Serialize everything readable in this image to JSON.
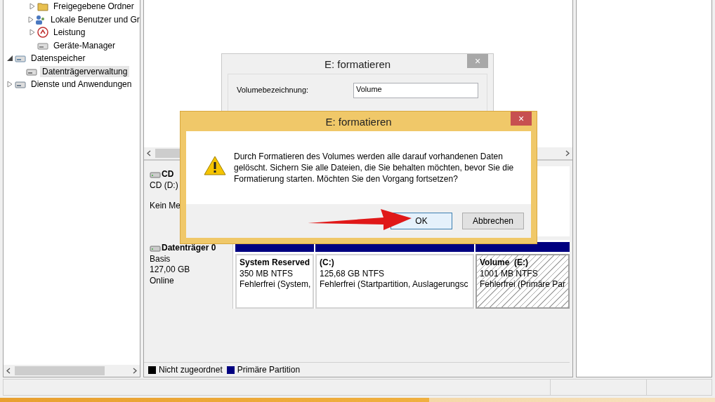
{
  "tree": {
    "orphan_children": [
      {
        "label": "Freigegebene Ordner",
        "kind": "folder",
        "expanded": false,
        "selected": false
      },
      {
        "label": "Lokale Benutzer und Gr",
        "kind": "users",
        "expanded": false,
        "selected": false
      },
      {
        "label": "Leistung",
        "kind": "gauge",
        "expanded": false,
        "selected": false
      },
      {
        "label": "Geräte-Manager",
        "kind": "device",
        "selected": false
      }
    ],
    "items": [
      {
        "label": "Datenspeicher",
        "kind": "storage",
        "expanded": true,
        "selected": false,
        "children": [
          {
            "label": "Datenträgerverwaltung",
            "kind": "disk",
            "selected": true
          }
        ]
      },
      {
        "label": "Dienste und Anwendungen",
        "kind": "services",
        "expanded": false,
        "selected": false
      }
    ]
  },
  "cd_drive": {
    "title": "CD",
    "drive": "CD (D:)",
    "media": "Kein Me"
  },
  "disk": {
    "title": "Datenträger 0",
    "type": "Basis",
    "size": "127,00 GB",
    "status": "Online",
    "partitions": [
      {
        "name": "System Reserved",
        "size": "350 MB NTFS",
        "health": "Fehlerfrei (System,",
        "selected": false
      },
      {
        "name": "(C:)",
        "size": "125,68 GB NTFS",
        "health": "Fehlerfrei (Startpartition, Auslagerungsc",
        "selected": false
      },
      {
        "name": "Volume  (E:)",
        "size": "1001 MB NTFS",
        "health": "Fehlerfrei (Primäre Par",
        "selected": true
      }
    ]
  },
  "legend": [
    {
      "label": "Nicht zugeordnet",
      "color": "#000000"
    },
    {
      "label": "Primäre Partition",
      "color": "#000080"
    }
  ],
  "back_dialog": {
    "title": "E: formatieren",
    "close": "×",
    "field_label": "Volumebezeichnung:",
    "field_value": "Volume"
  },
  "confirm_dialog": {
    "title": "E: formatieren",
    "close": "×",
    "message": "Durch Formatieren des Volumes werden alle darauf vorhandenen Daten gelöscht. Sichern Sie alle Dateien, die Sie behalten möchten, bevor Sie die Formatierung starten. Möchten Sie den Vorgang fortsetzen?",
    "buttons": [
      {
        "label": "OK",
        "selected": true
      },
      {
        "label": "Abbrechen",
        "selected": false
      }
    ]
  }
}
